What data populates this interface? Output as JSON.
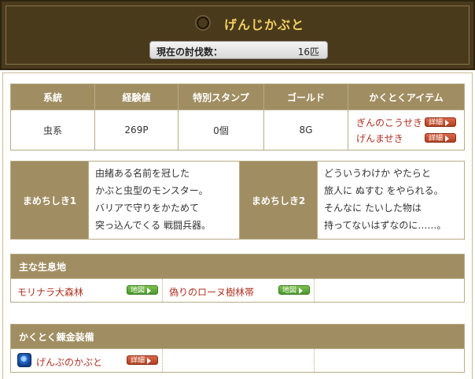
{
  "header": {
    "monster_name": "げんじかぶと",
    "kill_label": "現在の討伐数：",
    "kill_count": "16匹"
  },
  "stats": {
    "headers": [
      "系統",
      "経験値",
      "特別スタンプ",
      "ゴールド",
      "かくとくアイテム"
    ],
    "category": "虫系",
    "exp": "269P",
    "stamp": "0個",
    "gold": "8G",
    "items": [
      {
        "name": "ぎんのこうせき",
        "button": "詳細"
      },
      {
        "name": "げんませき",
        "button": "詳細"
      }
    ]
  },
  "trivia": [
    {
      "label": "まめちしき1",
      "lines": [
        "由緒ある名前を冠した",
        "かぶと虫型のモンスター。",
        "バリアで守りをかためて",
        "突っ込んでくる 戦闘兵器。"
      ]
    },
    {
      "label": "まめちしき2",
      "lines": [
        "どういうわけか やたらと",
        "旅人に ぬすむ をやられる。",
        "そんなに たいした物は",
        "持ってないはずなのに……。"
      ]
    }
  ],
  "habitat": {
    "title": "主な生息地",
    "places": [
      {
        "name": "モリナラ大森林",
        "button": "地図"
      },
      {
        "name": "偽りのローヌ樹林帯",
        "button": "地図"
      }
    ]
  },
  "equipment": {
    "title": "かくとく錬金装備",
    "items": [
      {
        "name": "げんぶのかぶと",
        "button": "詳細",
        "icon": "helmet-icon"
      }
    ]
  }
}
